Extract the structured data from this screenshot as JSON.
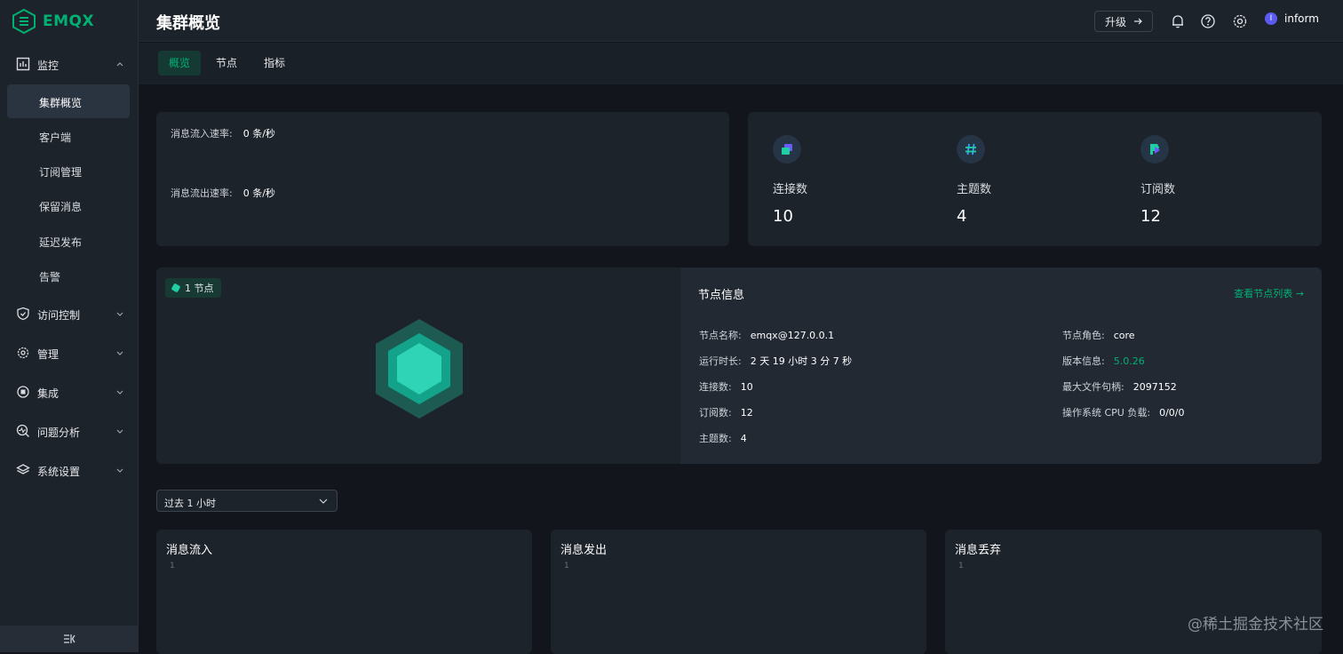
{
  "app": {
    "name": "EMQX",
    "accent": "#00b173"
  },
  "sidebar": {
    "groups": [
      {
        "label": "监控",
        "icon": "chart-icon",
        "expanded": true
      },
      {
        "label": "访问控制",
        "icon": "shield-icon"
      },
      {
        "label": "管理",
        "icon": "gear-icon"
      },
      {
        "label": "集成",
        "icon": "integration-icon"
      },
      {
        "label": "问题分析",
        "icon": "diagnose-icon"
      },
      {
        "label": "系统设置",
        "icon": "layers-icon"
      }
    ],
    "monitor_items": [
      {
        "label": "集群概览",
        "active": true
      },
      {
        "label": "客户端"
      },
      {
        "label": "订阅管理"
      },
      {
        "label": "保留消息"
      },
      {
        "label": "延迟发布"
      },
      {
        "label": "告警"
      }
    ],
    "collapse_icon": "collapse-icon"
  },
  "header": {
    "title": "集群概览",
    "upgrade_label": "升级",
    "user_initial": "I",
    "username": "inform"
  },
  "tabs": [
    {
      "label": "概览",
      "active": true
    },
    {
      "label": "节点"
    },
    {
      "label": "指标"
    }
  ],
  "rates": {
    "in_label": "消息流入速率:",
    "in_value": "0 条/秒",
    "out_label": "消息流出速率:",
    "out_value": "0 条/秒"
  },
  "stats": [
    {
      "label": "连接数",
      "value": "10",
      "icon": "connection-icon"
    },
    {
      "label": "主题数",
      "value": "4",
      "icon": "hash-icon"
    },
    {
      "label": "订阅数",
      "value": "12",
      "icon": "subscribe-icon"
    }
  ],
  "node_badge": "1 节点",
  "node_info": {
    "title": "节点信息",
    "link": "查看节点列表 →",
    "left": [
      {
        "label": "节点名称:",
        "value": "emqx@127.0.0.1"
      },
      {
        "label": "运行时长:",
        "value": "2 天 19 小时 3 分 7 秒"
      },
      {
        "label": "连接数:",
        "value": "10"
      },
      {
        "label": "订阅数:",
        "value": "12"
      },
      {
        "label": "主题数:",
        "value": "4"
      }
    ],
    "right": [
      {
        "label": "节点角色:",
        "value": "core"
      },
      {
        "label": "版本信息:",
        "value": "5.0.26"
      },
      {
        "label": "最大文件句柄:",
        "value": "2097152"
      },
      {
        "label": "操作系统 CPU 负载:",
        "value": "0/0/0"
      }
    ]
  },
  "time_range": {
    "selected": "过去 1 小时"
  },
  "metrics": [
    {
      "title": "消息流入",
      "tick": "1"
    },
    {
      "title": "消息发出",
      "tick": "1"
    },
    {
      "title": "消息丢弃",
      "tick": "1"
    }
  ],
  "watermark": "@稀土掘金技术社区"
}
